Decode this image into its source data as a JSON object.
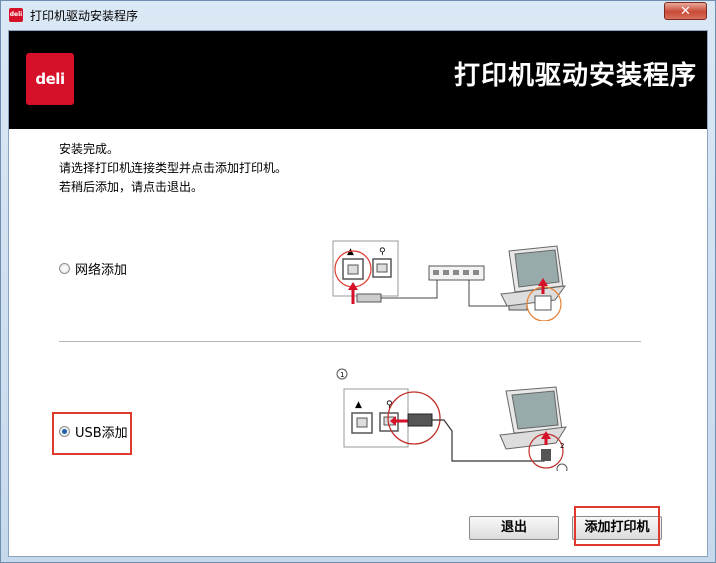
{
  "window": {
    "title": "打印机驱动安装程序",
    "close_glyph": "✕",
    "title_logo_text": "deli"
  },
  "banner": {
    "logo_text": "deli",
    "title": "打印机驱动安装程序"
  },
  "instructions": [
    "安装完成。",
    "请选择打印机连接类型并点击添加打印机。",
    "若稍后添加，请点击退出。"
  ],
  "options": {
    "network": {
      "label": "网络添加",
      "checked": false
    },
    "usb": {
      "label": "USB添加",
      "checked": true
    }
  },
  "diagram": {
    "step1": "1",
    "step2": "2"
  },
  "buttons": {
    "exit": "退出",
    "add_printer": "添加打印机"
  },
  "colors": {
    "brand_red": "#d7102a",
    "highlight_red": "#e03a2e",
    "banner_bg": "#000000",
    "radio_selected": "#1f5fae"
  }
}
